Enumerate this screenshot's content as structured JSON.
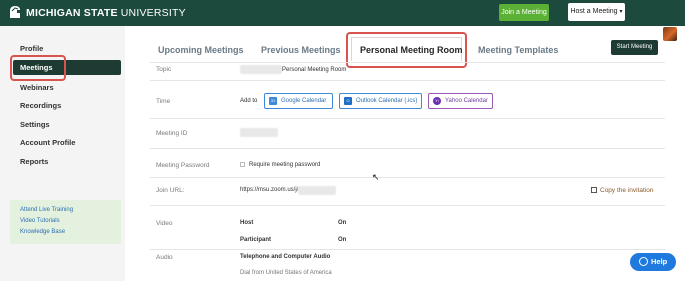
{
  "header": {
    "logo_bold": "MICHIGAN STATE",
    "logo_light": " UNIVERSITY",
    "join_label": "Join a Meeting",
    "host_label": "Host a Meeting",
    "host_caret": "▾"
  },
  "sidebar": {
    "items": [
      "Profile",
      "Meetings",
      "Webinars",
      "Recordings",
      "Settings",
      "Account Profile",
      "Reports"
    ],
    "links": [
      "Attend Live Training",
      "Video Tutorials",
      "Knowledge Base"
    ]
  },
  "tabs": [
    "Upcoming Meetings",
    "Previous Meetings",
    "Personal Meeting Room",
    "Meeting Templates"
  ],
  "start_label": "Start Meeting",
  "rows": {
    "topic": {
      "label": "Topic",
      "value": "Personal Meeting Room"
    },
    "time": {
      "label": "Time",
      "add_to": "Add to",
      "google": "Google Calendar",
      "outlook": "Outlook Calendar (.ics)",
      "yahoo": "Yahoo Calendar",
      "google_icon": "31",
      "outlook_icon": "O",
      "yahoo_icon": "Y!"
    },
    "meeting_id": {
      "label": "Meeting ID"
    },
    "password": {
      "label": "Meeting Password",
      "value": "Require meeting password"
    },
    "join_url": {
      "label": "Join URL:",
      "value": "https://msu.zoom.us/j/",
      "copy": "Copy the invitation"
    },
    "video": {
      "label": "Video",
      "host": "Host",
      "host_val": "On",
      "participant": "Participant",
      "participant_val": "On"
    },
    "audio": {
      "label": "Audio",
      "value": "Telephone and Computer Audio",
      "dial": "Dial from United States of America"
    }
  },
  "help_label": "Help",
  "icons": {
    "logo": "spartan-helmet-icon",
    "avatar": "user-avatar",
    "checkbox": "checkbox-icon",
    "copy": "copy-icon",
    "help": "chat-bubble-icon",
    "cursor": "mouse-cursor-icon"
  },
  "colors": {
    "header_bg": "#1c4a3d",
    "active_bg": "#1d3b32",
    "join_green": "#5bb135",
    "highlight_red": "#d9534f",
    "help_blue": "#1f7ae0"
  }
}
